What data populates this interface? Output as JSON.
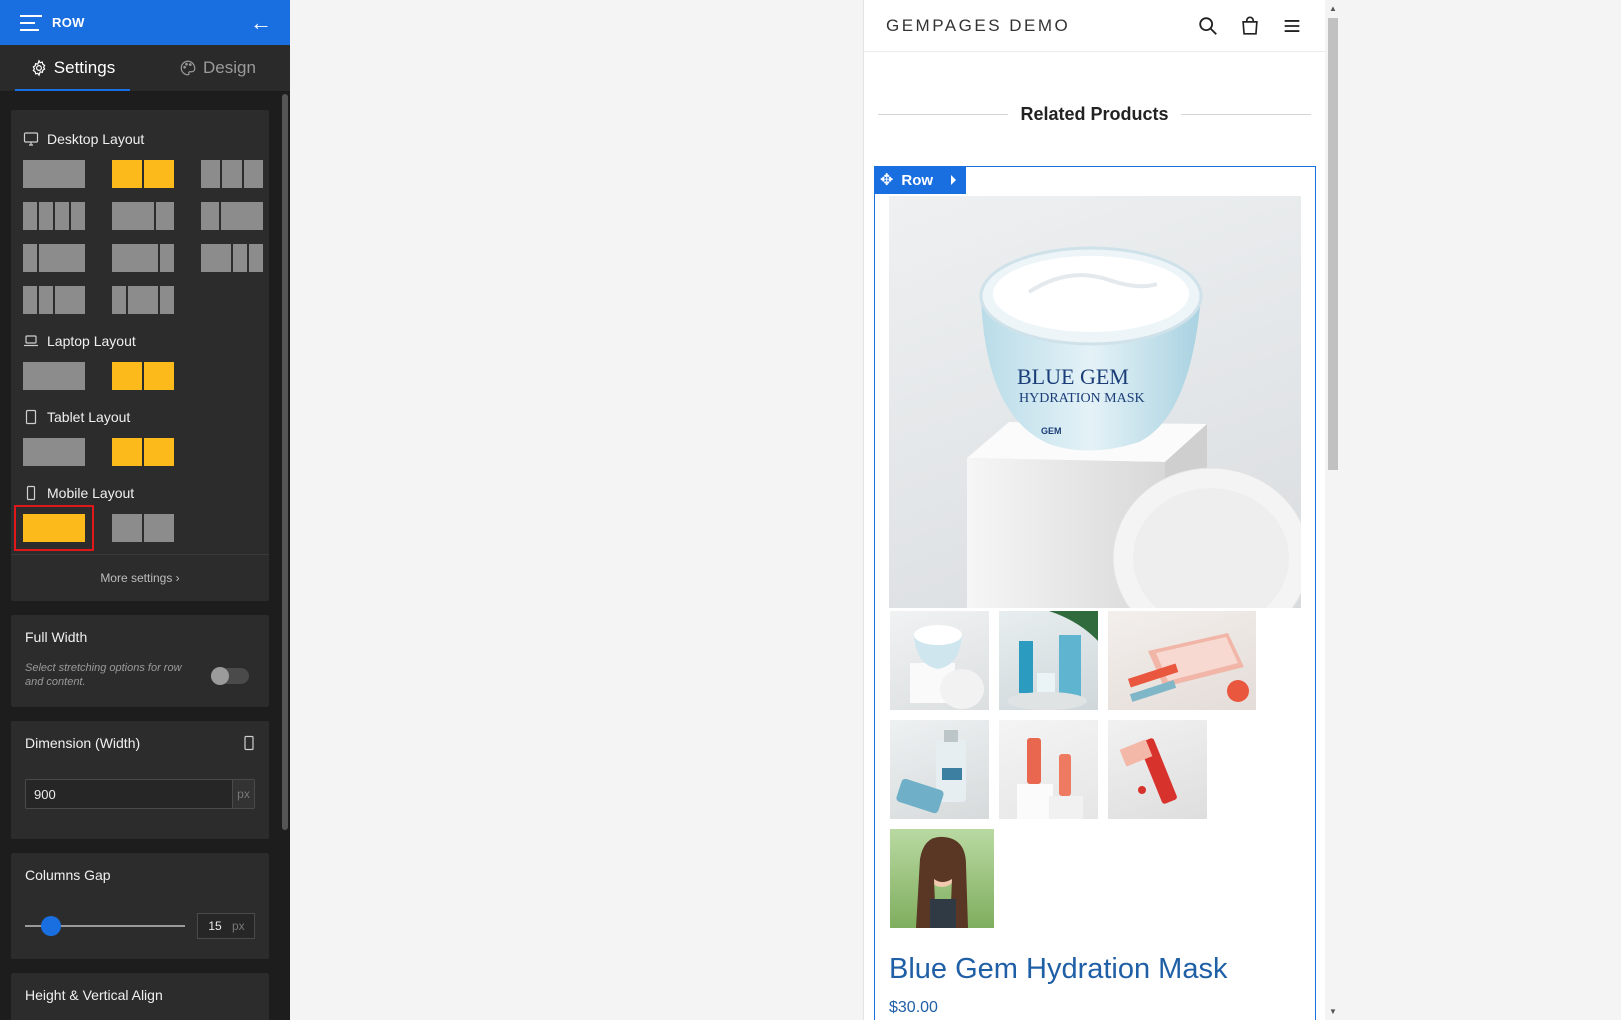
{
  "sidebar": {
    "header_title": "ROW",
    "tabs": [
      {
        "label": "Settings",
        "active": true
      },
      {
        "label": "Design",
        "active": false
      }
    ],
    "layouts": [
      {
        "label": "Desktop Layout",
        "icon": "desktop-icon"
      },
      {
        "label": "Laptop Layout",
        "icon": "laptop-icon"
      },
      {
        "label": "Tablet Layout",
        "icon": "tablet-icon"
      },
      {
        "label": "Mobile Layout",
        "icon": "mobile-icon"
      }
    ],
    "more_settings": "More settings ›",
    "full_width": {
      "title": "Full Width",
      "description": "Select stretching options for row and content.",
      "enabled": false
    },
    "dimension": {
      "title": "Dimension (Width)",
      "value": "900",
      "unit": "px"
    },
    "columns_gap": {
      "title": "Columns Gap",
      "value": "15",
      "unit": "px"
    },
    "height_align": {
      "title": "Height & Vertical Align"
    },
    "colors": {
      "accent": "#1a6fe0",
      "selected": "#fdbb1b",
      "highlight": "#e0181b"
    }
  },
  "store": {
    "logo": "GEMPAGES DEMO",
    "section_title": "Related Products",
    "row_tag": "Row",
    "hero_alt": "Blue Gem Hydration Mask jar on white pedestal",
    "jar_text_1": "BLUE GEM",
    "jar_text_2": "HYDRATION MASK",
    "jar_text_3": "GEM",
    "product_title": "Blue Gem Hydration Mask",
    "price": "$30.00"
  }
}
